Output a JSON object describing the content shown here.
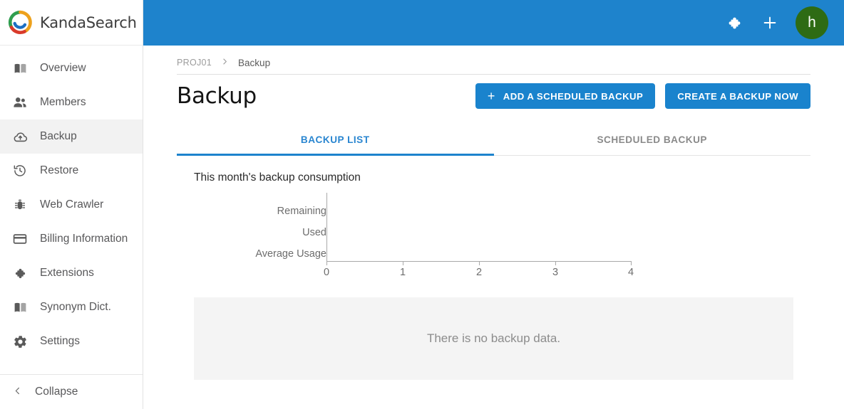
{
  "brand": {
    "name": "KandaSearch",
    "logo_icon": "kanda-ring-logo"
  },
  "sidebar": {
    "items": [
      {
        "label": "Overview",
        "icon": "book-icon",
        "active": false
      },
      {
        "label": "Members",
        "icon": "people-icon",
        "active": false
      },
      {
        "label": "Backup",
        "icon": "cloud-upload-icon",
        "active": true
      },
      {
        "label": "Restore",
        "icon": "history-restore-icon",
        "active": false
      },
      {
        "label": "Web Crawler",
        "icon": "bug-icon",
        "active": false
      },
      {
        "label": "Billing Information",
        "icon": "credit-card-icon",
        "active": false
      },
      {
        "label": "Extensions",
        "icon": "puzzle-icon",
        "active": false
      },
      {
        "label": "Synonym Dict.",
        "icon": "book-icon",
        "active": false
      },
      {
        "label": "Settings",
        "icon": "gear-icon",
        "active": false
      }
    ],
    "collapse": {
      "label": "Collapse",
      "icon": "chevron-left-icon"
    }
  },
  "topbar": {
    "extensions_icon": "puzzle-icon",
    "add_icon": "plus-icon",
    "avatar_initial": "h",
    "background_color": "#1e83cc",
    "avatar_color": "#2e6b14"
  },
  "breadcrumb": {
    "project": "PROJ01",
    "separator": "›",
    "current": "Backup"
  },
  "page": {
    "title": "Backup"
  },
  "actions": {
    "add_scheduled_backup": "ADD A SCHEDULED BACKUP",
    "add_scheduled_backup_icon": "plus-icon",
    "create_backup_now": "CREATE A BACKUP NOW",
    "button_color": "#1a83cd"
  },
  "tabs": {
    "items": [
      {
        "label": "BACKUP LIST",
        "active": true
      },
      {
        "label": "SCHEDULED BACKUP",
        "active": false
      }
    ],
    "active_color": "#2a86d0"
  },
  "chart_data": {
    "type": "bar",
    "orientation": "horizontal",
    "title": "This month's backup consumption",
    "categories": [
      "Remaining",
      "Used",
      "Average Usage"
    ],
    "values": [
      0,
      0,
      0
    ],
    "xlabel": "",
    "ylabel": "",
    "xlim": [
      0,
      4
    ],
    "xticks": [
      0,
      1,
      2,
      3,
      4
    ],
    "xtick_labels": [
      "0",
      "1",
      "2",
      "3",
      "4"
    ],
    "grid": false,
    "legend": false,
    "empty": true
  },
  "empty_state": {
    "message": "There is no backup data.",
    "background_color": "#f4f4f4"
  }
}
